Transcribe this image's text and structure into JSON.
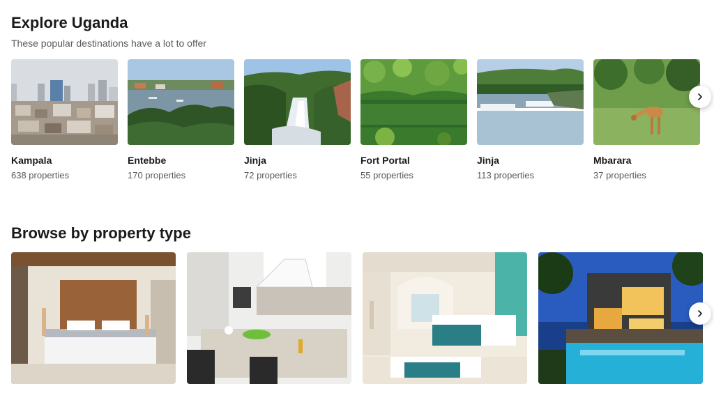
{
  "explore": {
    "title": "Explore Uganda",
    "subtitle": "These popular destinations have a lot to offer",
    "destinations": [
      {
        "name": "Kampala",
        "count": "638 properties",
        "image": "city-skyline"
      },
      {
        "name": "Entebbe",
        "count": "170 properties",
        "image": "lake-shore"
      },
      {
        "name": "Jinja",
        "count": "72 properties",
        "image": "waterfall"
      },
      {
        "name": "Fort Portal",
        "count": "55 properties",
        "image": "forest-lake"
      },
      {
        "name": "Jinja",
        "count": "113 properties",
        "image": "river-rapids"
      },
      {
        "name": "Mbarara",
        "count": "37 properties",
        "image": "giraffe"
      }
    ],
    "next_icon": "chevron-right-icon"
  },
  "browse": {
    "title": "Browse by property type",
    "properties": [
      {
        "image": "hotel-bedroom"
      },
      {
        "image": "apartment-kitchen"
      },
      {
        "image": "resort-room"
      },
      {
        "image": "villa-pool"
      }
    ],
    "next_icon": "chevron-right-icon"
  }
}
